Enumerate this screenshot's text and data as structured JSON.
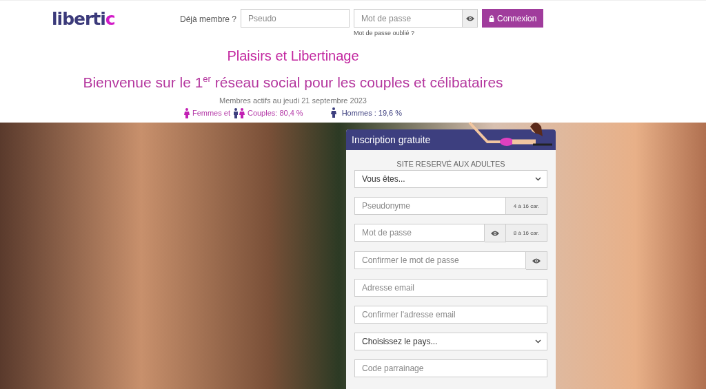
{
  "header": {
    "logo": "liberti",
    "logo_accent": "c",
    "member_label": "Déjà membre ?",
    "login_placeholder": "Pseudo",
    "password_placeholder": "Mot de passe",
    "login_button": "Connexion",
    "forgot_link": "Mot de passe oublié ?"
  },
  "titles": {
    "heading": "Plaisirs et Libertinage",
    "subheading": "Bienvenue sur le 1$^{er}$ réseau social pour les couples et célibataires"
  },
  "stats": {
    "date_line": "Membres actifs au jeudi 21 septembre 2023",
    "women_couples": "Femmes et",
    "couples": "Couples: 80,4 %",
    "men": "Hommes : 19,6 %"
  },
  "signup": {
    "title": "Inscription gratuite",
    "notice": "SITE RESERVÉ AUX ADULTES",
    "fields": [
      {
        "kind": "select",
        "value": "Vous êtes..."
      },
      {
        "kind": "text",
        "placeholder": "Pseudonyme",
        "hint": "4 à 16 car."
      },
      {
        "kind": "password",
        "placeholder": "Mot de passe",
        "hint": "8 à 16 car."
      },
      {
        "kind": "password",
        "placeholder": "Confirmer le mot de passe"
      },
      {
        "kind": "text",
        "placeholder": "Adresse email"
      },
      {
        "kind": "text",
        "placeholder": "Confirmer l'adresse email"
      },
      {
        "kind": "select",
        "value": "Choisissez le pays..."
      },
      {
        "kind": "text",
        "placeholder": "Code parrainage"
      }
    ]
  }
}
